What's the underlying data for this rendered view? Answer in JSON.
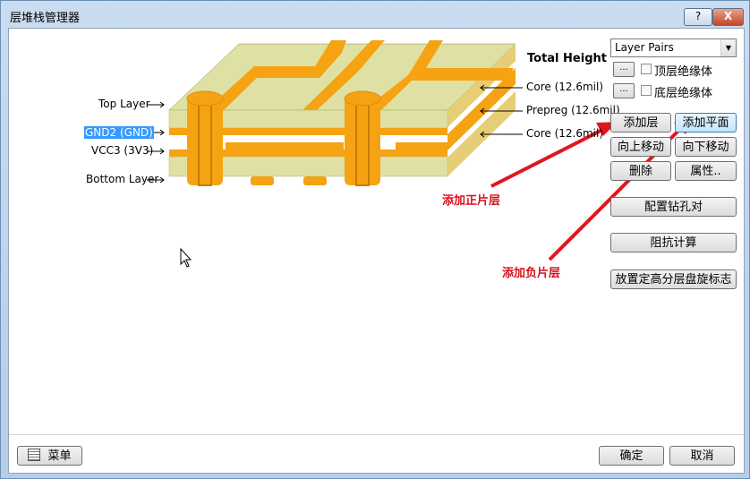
{
  "window": {
    "title": "层堆栈管理器",
    "help": "?",
    "close": "X"
  },
  "layer_labels": {
    "top_layer": "Top Layer",
    "gnd2": "GND2 (GND)",
    "vcc3": "VCC3 (3V3)",
    "bottom_layer": "Bottom Layer"
  },
  "stack_labels": {
    "total_height": "Total Height (",
    "core1": "Core (12.6mil)",
    "prepreg": "Prepreg (12.6mil)",
    "core2": "Core (12.6mil)"
  },
  "panel": {
    "layer_pairs": "Layer Pairs",
    "dots": "...",
    "top_insulation": "顶层绝缘体",
    "bottom_insulation": "底层绝缘体",
    "add_layer": "添加层",
    "add_plane": "添加平面",
    "move_up": "向上移动",
    "move_down": "向下移动",
    "delete": "删除",
    "properties": "属性..",
    "drill_pairs": "配置钻孔对",
    "impedance": "阻抗计算",
    "place_legend": "放置定高分层盘旋标志"
  },
  "annotations": {
    "positive": "添加正片层",
    "negative": "添加负片层"
  },
  "footer": {
    "menu": "菜单",
    "ok": "确定",
    "cancel": "取消"
  },
  "colors": {
    "accent_red": "#e0161f",
    "copper": "#f5a313",
    "dielectric": "#dfe0a3"
  }
}
